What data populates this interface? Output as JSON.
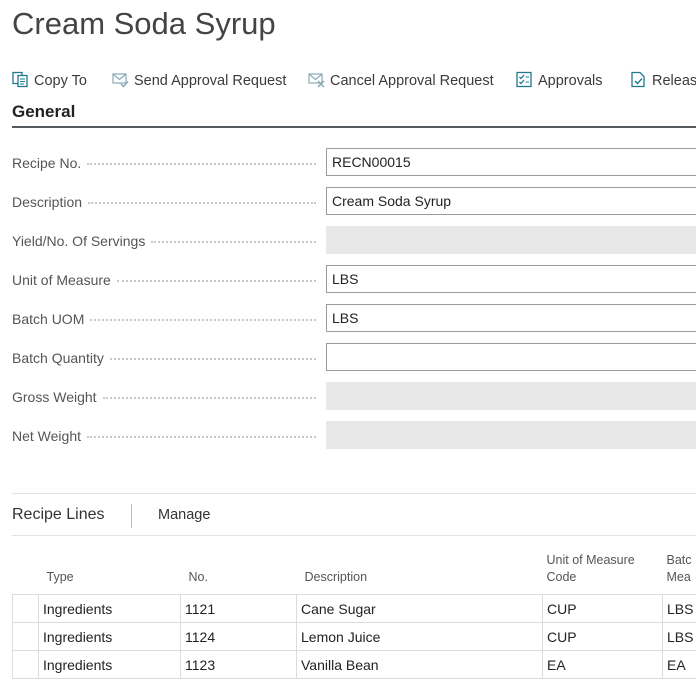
{
  "page": {
    "title": "Cream Soda Syrup"
  },
  "toolbar": {
    "copy_to": "Copy To",
    "send_approval": "Send Approval Request",
    "cancel_approval": "Cancel Approval Request",
    "approvals": "Approvals",
    "release": "Release"
  },
  "general": {
    "heading": "General",
    "fields": [
      {
        "label": "Recipe No.",
        "value": "RECN00015",
        "editable": true
      },
      {
        "label": "Description",
        "value": "Cream Soda Syrup",
        "editable": true
      },
      {
        "label": "Yield/No. Of Servings",
        "value": "",
        "editable": false
      },
      {
        "label": "Unit of Measure",
        "value": "LBS",
        "editable": true
      },
      {
        "label": "Batch UOM",
        "value": "LBS",
        "editable": true
      },
      {
        "label": "Batch Quantity",
        "value": "",
        "editable": true
      },
      {
        "label": "Gross Weight",
        "value": "",
        "editable": false
      },
      {
        "label": "Net Weight",
        "value": "",
        "editable": false
      }
    ]
  },
  "recipe_lines": {
    "heading": "Recipe Lines",
    "manage": "Manage",
    "columns": {
      "type": "Type",
      "no": "No.",
      "description": "Description",
      "uom_line1": "Unit of Measure",
      "uom_line2": "Code",
      "batch_line1": "Batc",
      "batch_line2": "Mea"
    },
    "rows": [
      {
        "type": "Ingredients",
        "no": "1121",
        "description": "Cane Sugar",
        "uom": "CUP",
        "batch_uom": "LBS"
      },
      {
        "type": "Ingredients",
        "no": "1124",
        "description": "Lemon Juice",
        "uom": "CUP",
        "batch_uom": "LBS"
      },
      {
        "type": "Ingredients",
        "no": "1123",
        "description": "Vanilla Bean",
        "uom": "EA",
        "batch_uom": "EA"
      }
    ]
  },
  "colors": {
    "accent": "#1e7a8c",
    "heading_rule": "#555a5e",
    "readonly_fill": "#e8e8e8"
  },
  "icons": [
    "copy-icon",
    "send-approval-icon",
    "cancel-approval-icon",
    "approvals-icon",
    "release-icon"
  ]
}
